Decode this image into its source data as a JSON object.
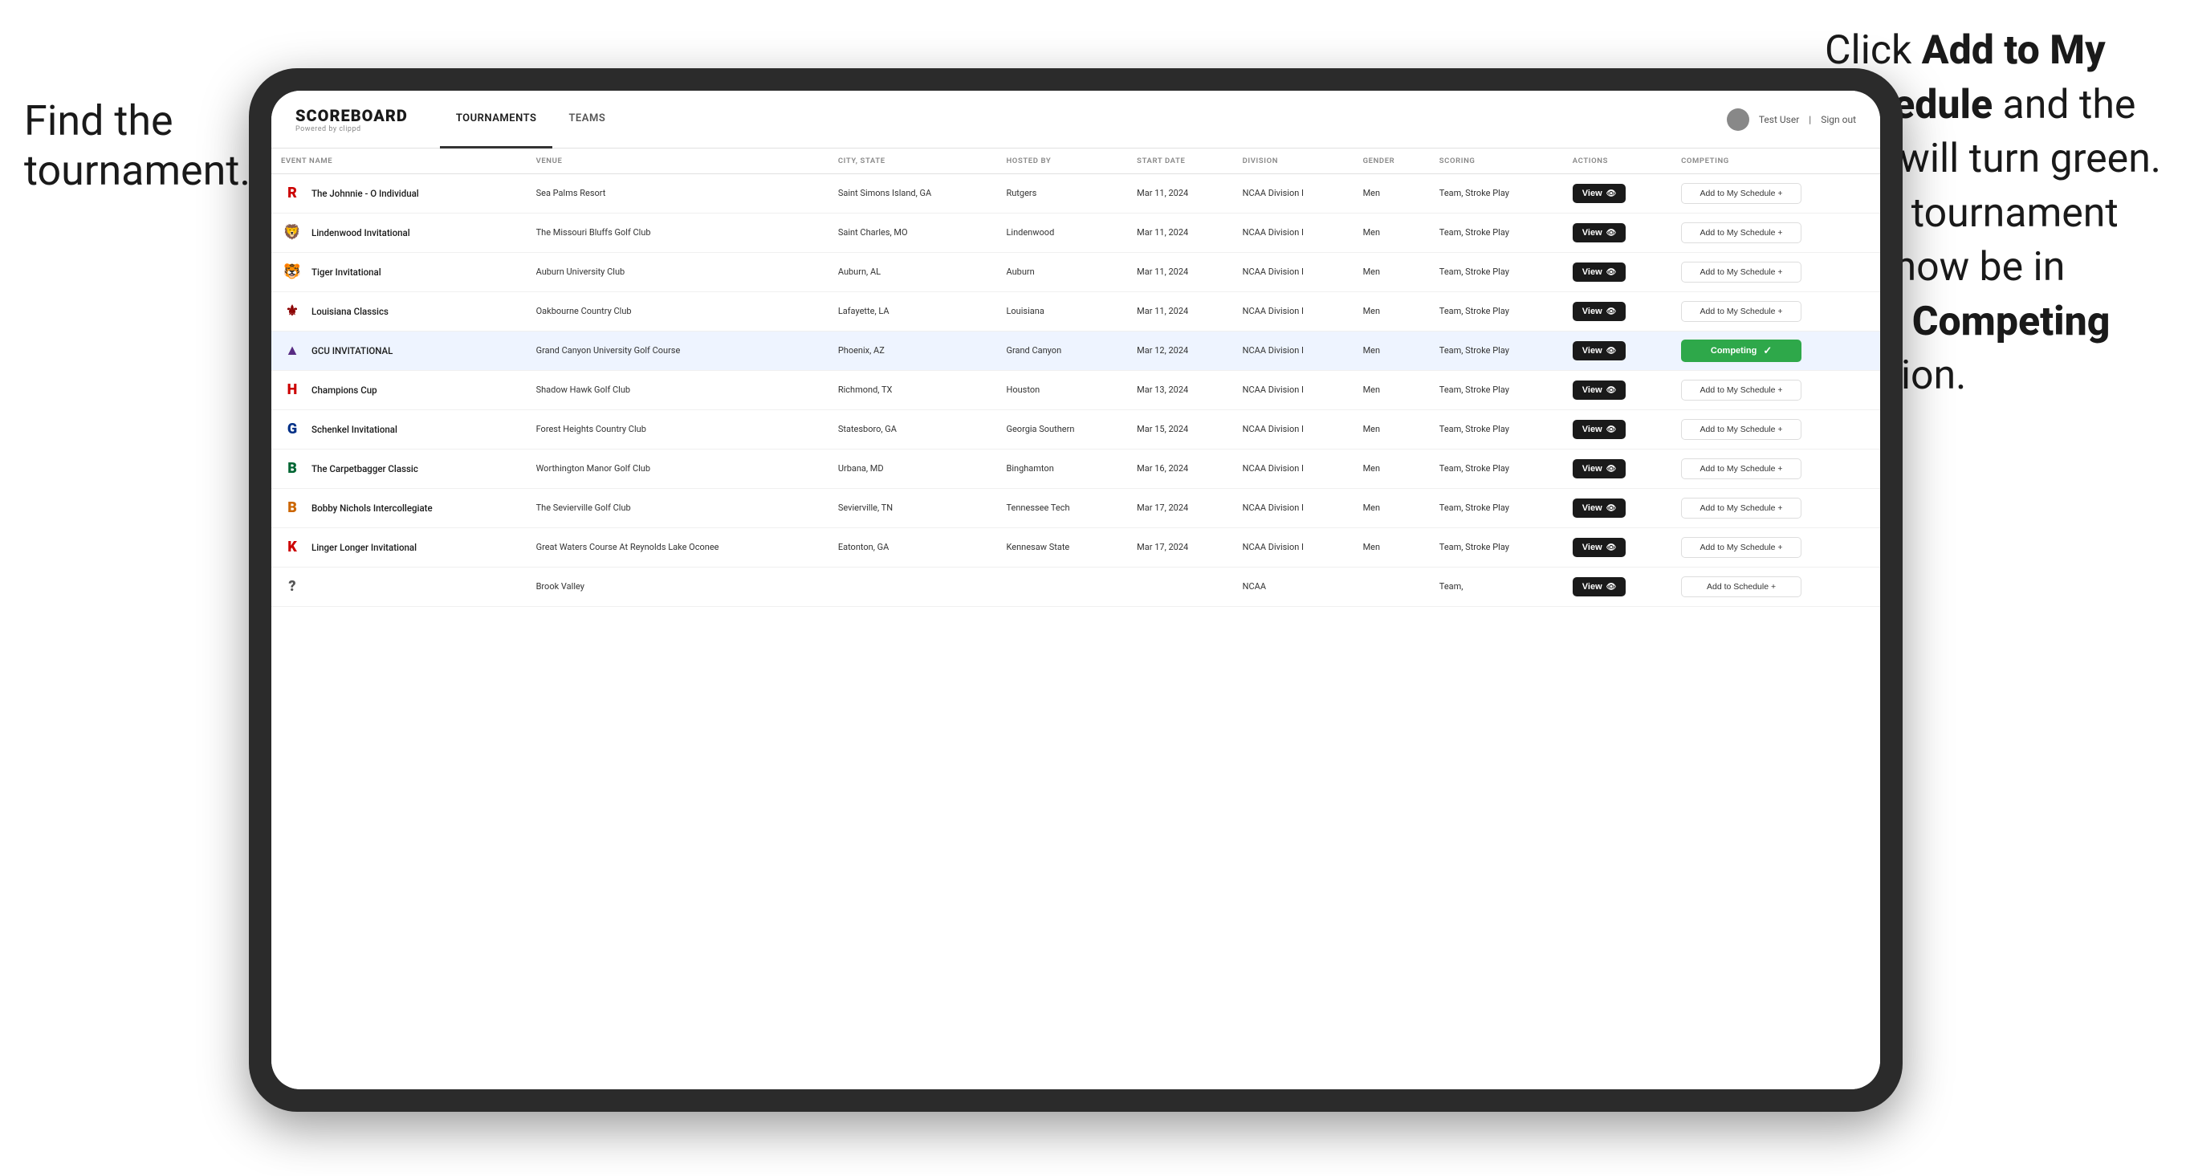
{
  "annotations": {
    "left": "Find the\ntournament.",
    "right_line1": "Click ",
    "right_bold1": "Add to My\nSchedule",
    "right_line2": " and the\nbox will turn green.\nThis tournament\nwill now be in\nyour ",
    "right_bold2": "Competing",
    "right_line3": "\nsection."
  },
  "app": {
    "logo": "SCOREBOARD",
    "logo_sub": "Powered by clippd",
    "nav_tabs": [
      {
        "label": "TOURNAMENTS",
        "active": true
      },
      {
        "label": "TEAMS",
        "active": false
      }
    ],
    "user_label": "Test User",
    "signout_label": "Sign out"
  },
  "table": {
    "columns": [
      {
        "id": "event_name",
        "label": "EVENT NAME"
      },
      {
        "id": "venue",
        "label": "VENUE"
      },
      {
        "id": "city_state",
        "label": "CITY, STATE"
      },
      {
        "id": "hosted_by",
        "label": "HOSTED BY"
      },
      {
        "id": "start_date",
        "label": "START DATE"
      },
      {
        "id": "division",
        "label": "DIVISION"
      },
      {
        "id": "gender",
        "label": "GENDER"
      },
      {
        "id": "scoring",
        "label": "SCORING"
      },
      {
        "id": "actions",
        "label": "ACTIONS"
      },
      {
        "id": "competing",
        "label": "COMPETING"
      }
    ],
    "rows": [
      {
        "logo": "🅁",
        "logo_color": "#cc0000",
        "event_name": "The Johnnie - O Individual",
        "venue": "Sea Palms Resort",
        "city_state": "Saint Simons Island, GA",
        "hosted_by": "Rutgers",
        "start_date": "Mar 11, 2024",
        "division": "NCAA Division I",
        "gender": "Men",
        "scoring": "Team, Stroke Play",
        "action": "View",
        "competing_status": "add",
        "competing_label": "Add to My Schedule +",
        "highlighted": false
      },
      {
        "logo": "🦁",
        "logo_color": "#003087",
        "event_name": "Lindenwood Invitational",
        "venue": "The Missouri Bluffs Golf Club",
        "city_state": "Saint Charles, MO",
        "hosted_by": "Lindenwood",
        "start_date": "Mar 11, 2024",
        "division": "NCAA Division I",
        "gender": "Men",
        "scoring": "Team, Stroke Play",
        "action": "View",
        "competing_status": "add",
        "competing_label": "Add to My Schedule +",
        "highlighted": false
      },
      {
        "logo": "🐯",
        "logo_color": "#ff6600",
        "event_name": "Tiger Invitational",
        "venue": "Auburn University Club",
        "city_state": "Auburn, AL",
        "hosted_by": "Auburn",
        "start_date": "Mar 11, 2024",
        "division": "NCAA Division I",
        "gender": "Men",
        "scoring": "Team, Stroke Play",
        "action": "View",
        "competing_status": "add",
        "competing_label": "Add to My Schedule +",
        "highlighted": false
      },
      {
        "logo": "⚜",
        "logo_color": "#8b0000",
        "event_name": "Louisiana Classics",
        "venue": "Oakbourne Country Club",
        "city_state": "Lafayette, LA",
        "hosted_by": "Louisiana",
        "start_date": "Mar 11, 2024",
        "division": "NCAA Division I",
        "gender": "Men",
        "scoring": "Team, Stroke Play",
        "action": "View",
        "competing_status": "add",
        "competing_label": "Add to My Schedule +",
        "highlighted": false
      },
      {
        "logo": "△",
        "logo_color": "#582c83",
        "event_name": "GCU INVITATIONAL",
        "venue": "Grand Canyon University Golf Course",
        "city_state": "Phoenix, AZ",
        "hosted_by": "Grand Canyon",
        "start_date": "Mar 12, 2024",
        "division": "NCAA Division I",
        "gender": "Men",
        "scoring": "Team, Stroke Play",
        "action": "View",
        "competing_status": "competing",
        "competing_label": "Competing ✓",
        "highlighted": true
      },
      {
        "logo": "H",
        "logo_color": "#cc0000",
        "event_name": "Champions Cup",
        "venue": "Shadow Hawk Golf Club",
        "city_state": "Richmond, TX",
        "hosted_by": "Houston",
        "start_date": "Mar 13, 2024",
        "division": "NCAA Division I",
        "gender": "Men",
        "scoring": "Team, Stroke Play",
        "action": "View",
        "competing_status": "add",
        "competing_label": "Add to My Schedule +",
        "highlighted": false
      },
      {
        "logo": "G",
        "logo_color": "#003087",
        "event_name": "Schenkel Invitational",
        "venue": "Forest Heights Country Club",
        "city_state": "Statesboro, GA",
        "hosted_by": "Georgia Southern",
        "start_date": "Mar 15, 2024",
        "division": "NCAA Division I",
        "gender": "Men",
        "scoring": "Team, Stroke Play",
        "action": "View",
        "competing_status": "add",
        "competing_label": "Add to My Schedule +",
        "highlighted": false
      },
      {
        "logo": "B",
        "logo_color": "#006633",
        "event_name": "The Carpetbagger Classic",
        "venue": "Worthington Manor Golf Club",
        "city_state": "Urbana, MD",
        "hosted_by": "Binghamton",
        "start_date": "Mar 16, 2024",
        "division": "NCAA Division I",
        "gender": "Men",
        "scoring": "Team, Stroke Play",
        "action": "View",
        "competing_status": "add",
        "competing_label": "Add to My Schedule +",
        "highlighted": false
      },
      {
        "logo": "B",
        "logo_color": "#cc6600",
        "event_name": "Bobby Nichols Intercollegiate",
        "venue": "The Sevierville Golf Club",
        "city_state": "Sevierville, TN",
        "hosted_by": "Tennessee Tech",
        "start_date": "Mar 17, 2024",
        "division": "NCAA Division I",
        "gender": "Men",
        "scoring": "Team, Stroke Play",
        "action": "View",
        "competing_status": "add",
        "competing_label": "Add to My Schedule +",
        "highlighted": false
      },
      {
        "logo": "K",
        "logo_color": "#cc0000",
        "event_name": "Linger Longer Invitational",
        "venue": "Great Waters Course At Reynolds Lake Oconee",
        "city_state": "Eatonton, GA",
        "hosted_by": "Kennesaw State",
        "start_date": "Mar 17, 2024",
        "division": "NCAA Division I",
        "gender": "Men",
        "scoring": "Team, Stroke Play",
        "action": "View",
        "competing_status": "add",
        "competing_label": "Add to My Schedule +",
        "highlighted": false
      },
      {
        "logo": "?",
        "logo_color": "#555",
        "event_name": "",
        "venue": "Brook Valley",
        "city_state": "",
        "hosted_by": "",
        "start_date": "",
        "division": "NCAA",
        "gender": "",
        "scoring": "Team,",
        "action": "View",
        "competing_status": "add",
        "competing_label": "Add to Schedule +",
        "highlighted": false
      }
    ]
  }
}
